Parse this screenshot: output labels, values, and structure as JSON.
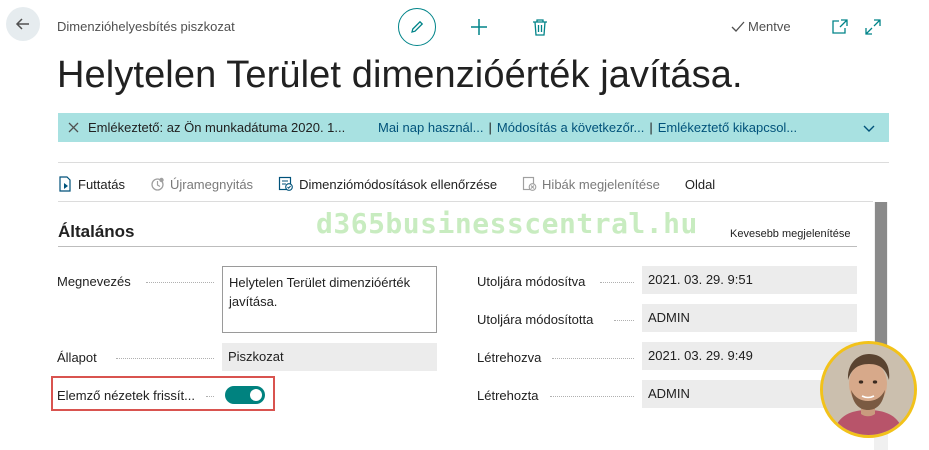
{
  "header": {
    "breadcrumb": "Dimenzióhelyesbítés piszkozat",
    "saved_label": "Mentve"
  },
  "page_title": "Helytelen Terület dimenzióérték javítása.",
  "notification": {
    "message": "Emlékeztető: az Ön munkadátuma 2020. 1...",
    "links": [
      "Mai nap használ...",
      "Módosítás a következőr...",
      "Emlékeztető kikapcsol..."
    ]
  },
  "actions": [
    {
      "label": "Futtatás",
      "icon": "run-icon",
      "disabled": false
    },
    {
      "label": "Újramegnyitás",
      "icon": "reopen-icon",
      "disabled": true
    },
    {
      "label": "Dimenziómódosítások ellenőrzése",
      "icon": "validate-icon",
      "disabled": false
    },
    {
      "label": "Hibák megjelenítése",
      "icon": "errors-icon",
      "disabled": true
    },
    {
      "label": "Oldal",
      "icon": "",
      "disabled": false
    }
  ],
  "watermark": "d365businesscentral.hu",
  "section": {
    "title": "Általános",
    "show_less": "Kevesebb megjelenítése"
  },
  "fields_left": {
    "description_label": "Megnevezés",
    "description_value": "Helytelen Terület dimenzióérték javítása.",
    "status_label": "Állapot",
    "status_value": "Piszkozat",
    "update_analysis_label": "Elemző nézetek frissít...",
    "update_analysis_value": true
  },
  "fields_right": {
    "last_modified_label": "Utoljára módosítva",
    "last_modified_value": "2021. 03. 29. 9:51",
    "last_modified_by_label": "Utoljára módosította",
    "last_modified_by_value": "ADMIN",
    "created_label": "Létrehozva",
    "created_value": "2021. 03. 29. 9:49",
    "created_by_label": "Létrehozta",
    "created_by_value": "ADMIN"
  },
  "colors": {
    "accent": "#008489",
    "notification_bg": "#a8e1e1",
    "toggle_on": "#00827f",
    "highlight": "#d9534f",
    "avatar_ring": "#f2c21a"
  }
}
